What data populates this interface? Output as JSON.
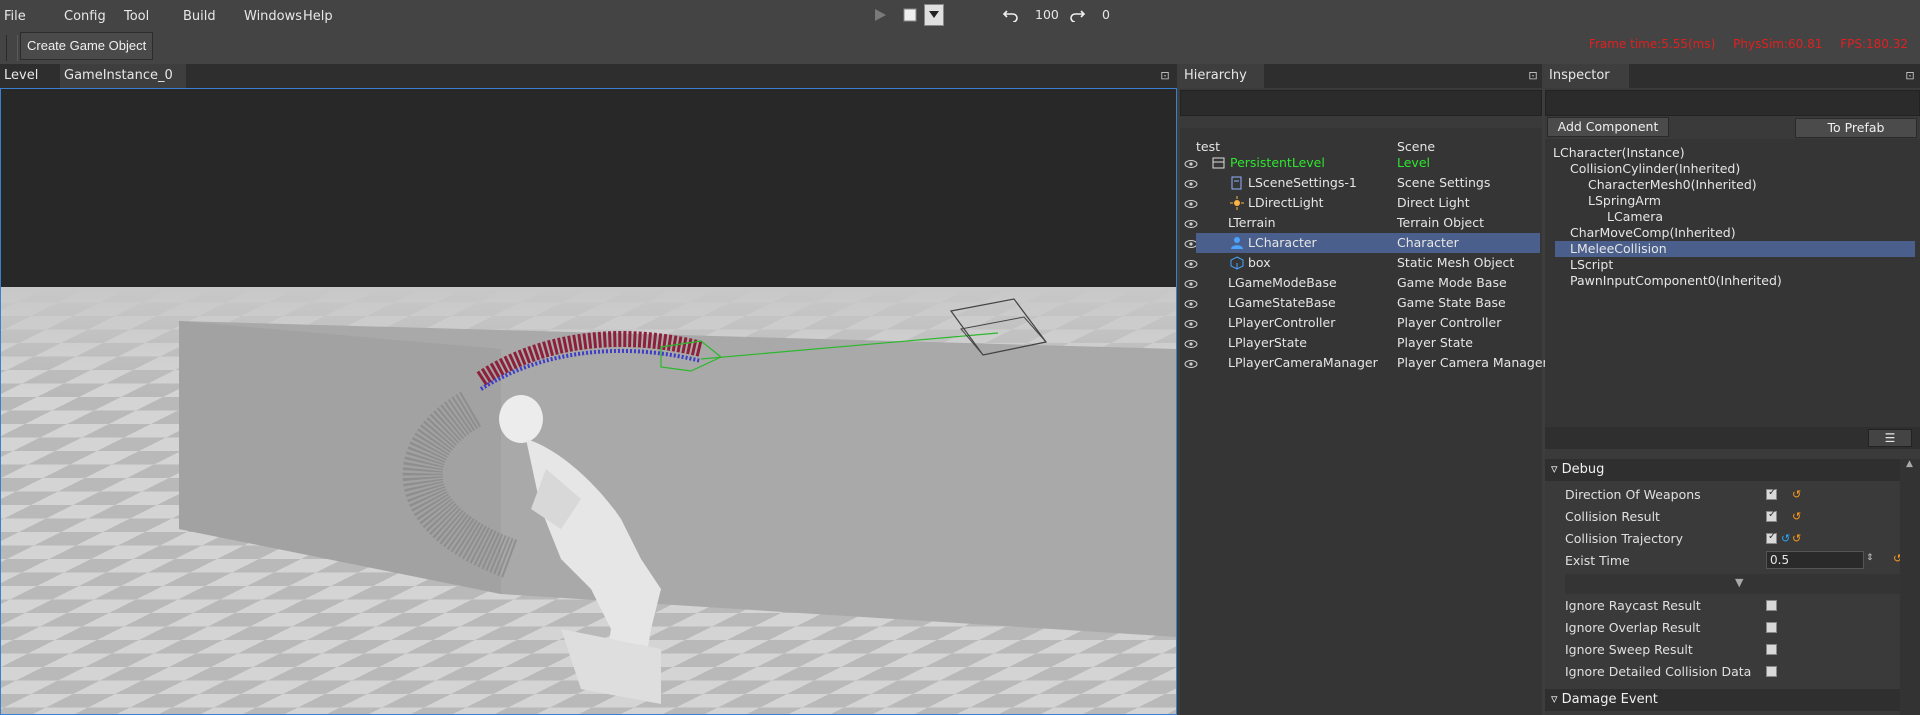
{
  "menu": [
    "File",
    "Config",
    "Tool",
    "Build",
    "Windows",
    "Help"
  ],
  "toolbar": {
    "undo_count": "100",
    "redo_count": "0"
  },
  "subbar": {
    "create_button": "Create Game Object"
  },
  "stats": {
    "frame_time": "Frame time:5.55(ms)",
    "physsim": "PhysSim:60.81",
    "fps": "FPS:180.32"
  },
  "viewport": {
    "tabs": [
      "Level",
      "GameInstance_0"
    ]
  },
  "hierarchy": {
    "title": "Hierarchy",
    "header": {
      "name": "test",
      "type": "Scene"
    },
    "items": [
      {
        "name": "PersistentLevel",
        "type": "Level"
      },
      {
        "name": "LSceneSettings-1",
        "type": "Scene Settings"
      },
      {
        "name": "LDirectLight",
        "type": "Direct Light"
      },
      {
        "name": "LTerrain",
        "type": "Terrain Object"
      },
      {
        "name": "LCharacter",
        "type": "Character"
      },
      {
        "name": "box",
        "type": "Static Mesh Object"
      },
      {
        "name": "LGameModeBase",
        "type": "Game Mode Base"
      },
      {
        "name": "LGameStateBase",
        "type": "Game State Base"
      },
      {
        "name": "LPlayerController",
        "type": "Player Controller"
      },
      {
        "name": "LPlayerState",
        "type": "Player State"
      },
      {
        "name": "LPlayerCameraManager",
        "type": "Player Camera Manager"
      }
    ],
    "colors": {
      "level": "#2ee62e",
      "selected": "#4b5f8c"
    }
  },
  "inspector": {
    "title": "Inspector",
    "add_component": "Add Component",
    "to_prefab": "To Prefab",
    "tree": [
      "LCharacter(Instance)",
      "CollisionCylinder(Inherited)",
      "CharacterMesh0(Inherited)",
      "LSpringArm",
      "LCamera",
      "CharMoveComp(Inherited)",
      "LMeleeCollision",
      "LScript",
      "PawnInputComponent0(Inherited)"
    ],
    "debug": {
      "section": "Debug",
      "direction_of_weapons": "Direction Of Weapons",
      "collision_result": "Collision Result",
      "collision_trajectory": "Collision Trajectory",
      "exist_time": "Exist Time",
      "exist_time_value": "0.5",
      "ignore_raycast": "Ignore Raycast Result",
      "ignore_overlap": "Ignore Overlap Result",
      "ignore_sweep": "Ignore Sweep Result",
      "ignore_detailed": "Ignore Detailed Collision Data"
    },
    "damage_section": "Damage Event"
  },
  "colors": {
    "accent": "#3b7fd0",
    "stats": "#e02020",
    "reset": "#ff9a1a"
  }
}
